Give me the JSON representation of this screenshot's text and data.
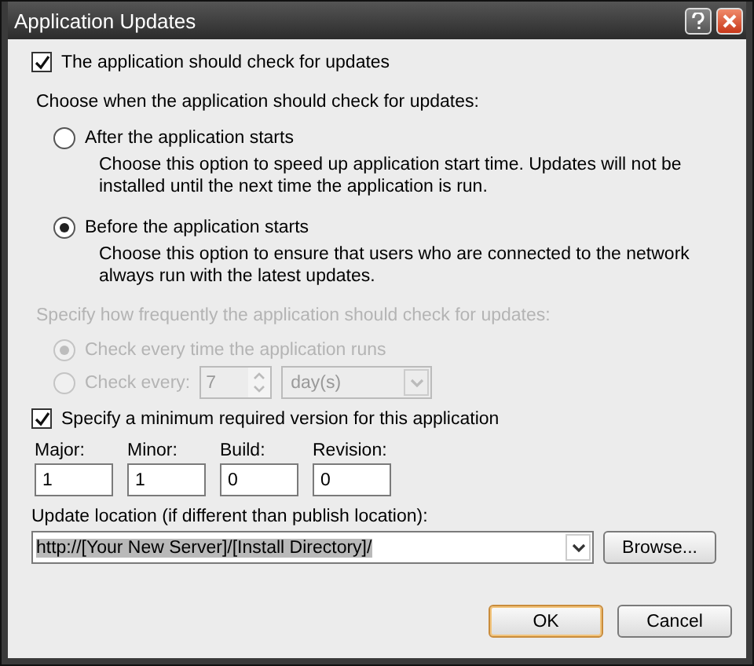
{
  "window": {
    "title": "Application Updates"
  },
  "check_updates": {
    "label": "The application should check for updates",
    "checked": true
  },
  "when_label": "Choose when the application should check for updates:",
  "when_options": [
    {
      "label": "After the application starts",
      "description": "Choose this option to speed up application start time. Updates will not be installed until the next time the application is run.",
      "selected": false
    },
    {
      "label": "Before the application starts",
      "description": "Choose this option to ensure that users who are connected to the network always run with the latest updates.",
      "selected": true
    }
  ],
  "frequency": {
    "label": "Specify how frequently the application should check for updates:",
    "disabled": true,
    "options": [
      {
        "kind": "plain",
        "label": "Check every time the application runs",
        "selected": true
      },
      {
        "kind": "interval",
        "label": "Check every:",
        "selected": false,
        "value": "7",
        "unit": "day(s)"
      }
    ]
  },
  "min_version": {
    "label": "Specify a minimum required version for this application",
    "checked": true,
    "fields": [
      {
        "label": "Major:",
        "value": "1"
      },
      {
        "label": "Minor:",
        "value": "1"
      },
      {
        "label": "Build:",
        "value": "0"
      },
      {
        "label": "Revision:",
        "value": "0"
      }
    ]
  },
  "update_location": {
    "label": "Update location (if different than publish location):",
    "value": "http://[Your New Server]/[Install Directory]/"
  },
  "browse_button": "Browse...",
  "buttons": [
    {
      "label": "OK",
      "default": true
    },
    {
      "label": "Cancel",
      "default": false
    }
  ]
}
